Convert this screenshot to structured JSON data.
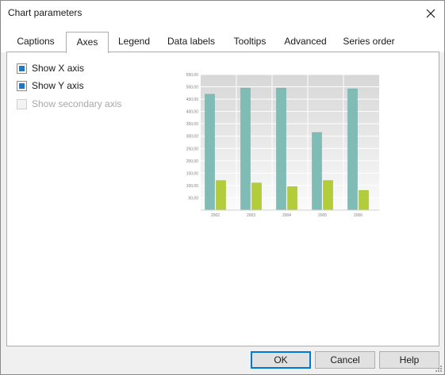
{
  "dialog": {
    "title": "Chart parameters"
  },
  "tabs": [
    {
      "label": "Captions",
      "active": false
    },
    {
      "label": "Axes",
      "active": true
    },
    {
      "label": "Legend",
      "active": false
    },
    {
      "label": "Data labels",
      "active": false
    },
    {
      "label": "Tooltips",
      "active": false
    },
    {
      "label": "Advanced",
      "active": false
    },
    {
      "label": "Series order",
      "active": false
    }
  ],
  "axes": {
    "show_x_axis": {
      "label": "Show X axis",
      "checked": true,
      "enabled": true
    },
    "show_y_axis": {
      "label": "Show Y axis",
      "checked": true,
      "enabled": true
    },
    "show_secondary_axis": {
      "label": "Show secondary axis",
      "checked": false,
      "enabled": false
    }
  },
  "chart_data": {
    "type": "bar",
    "categories": [
      "2002",
      "2003",
      "2004",
      "2005",
      "2006"
    ],
    "series": [
      {
        "values": [
          470,
          495,
          495,
          315,
          492
        ],
        "color": "#7fbcb5"
      },
      {
        "values": [
          120,
          110,
          95,
          120,
          80
        ],
        "color": "#b3cc3a"
      }
    ],
    "ylim": [
      0,
      550
    ],
    "yticks": [
      "50,00",
      "100,00",
      "150,00",
      "200,00",
      "250,00",
      "300,00",
      "350,00",
      "400,00",
      "450,00",
      "500,00",
      "550,00"
    ],
    "grid": true
  },
  "buttons": {
    "ok": "OK",
    "cancel": "Cancel",
    "help": "Help"
  },
  "colors": {
    "accent": "#1e78c6",
    "tab_border": "#adadad"
  }
}
